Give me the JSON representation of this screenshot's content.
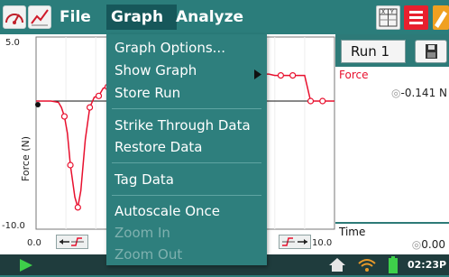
{
  "menubar": {
    "menus": [
      {
        "label": "File"
      },
      {
        "label": "Graph"
      },
      {
        "label": "Analyze"
      }
    ]
  },
  "graph_menu": {
    "items": [
      {
        "label": "Graph Options...",
        "enabled": true
      },
      {
        "label": "Show Graph",
        "enabled": true,
        "submenu": true
      },
      {
        "label": "Store Run",
        "enabled": true
      },
      {
        "label": "Strike Through Data",
        "enabled": true
      },
      {
        "label": "Restore Data",
        "enabled": true
      },
      {
        "label": "Tag Data",
        "enabled": true
      },
      {
        "label": "Autoscale Once",
        "enabled": true
      },
      {
        "label": "Zoom In",
        "enabled": false
      },
      {
        "label": "Zoom Out",
        "enabled": false
      }
    ]
  },
  "graph": {
    "y_max_label": "5.0",
    "y_min_label": "-10.0",
    "x_min_label": "0.0",
    "x_max_label": "10.0",
    "y_axis_label": "Force (N)"
  },
  "chart_data": {
    "type": "line",
    "title": "",
    "xlabel": "",
    "ylabel": "Force (N)",
    "xlim": [
      0,
      10
    ],
    "ylim": [
      -10,
      5
    ],
    "series": [
      {
        "name": "Force",
        "color": "#e8102e",
        "x": [
          0.0,
          0.25,
          0.5,
          0.75,
          0.85,
          0.95,
          1.05,
          1.15,
          1.3,
          1.4,
          1.5,
          1.65,
          1.8,
          1.95,
          2.1,
          2.25,
          2.4,
          2.55,
          2.7,
          2.85,
          3.0,
          3.1,
          3.15,
          3.3,
          3.5,
          3.6,
          3.75,
          4.0,
          4.5,
          5.0,
          5.5,
          6.0,
          6.5,
          6.8,
          7.0,
          7.2,
          7.4,
          7.6,
          7.8,
          8.0,
          8.2,
          8.4,
          8.6,
          8.8,
          9.0,
          9.2,
          9.5,
          9.8,
          10.0
        ],
        "y": [
          0.0,
          0.0,
          0.0,
          -0.1,
          -0.5,
          -1.2,
          -2.5,
          -5.0,
          -7.5,
          -8.3,
          -7.0,
          -3.0,
          -0.5,
          0.3,
          0.4,
          1.0,
          1.1,
          2.3,
          2.4,
          2.4,
          2.1,
          2.0,
          2.2,
          2.2,
          1.9,
          2.1,
          2.0,
          2.1,
          2.1,
          2.1,
          2.1,
          2.1,
          2.1,
          2.1,
          2.1,
          2.1,
          2.1,
          2.1,
          2.1,
          2.0,
          2.0,
          2.0,
          2.0,
          2.0,
          2.0,
          0.0,
          0.0,
          0.0,
          0.0
        ]
      }
    ],
    "marked_x": [
      0.95,
      1.15,
      1.4,
      1.8,
      2.1,
      2.4,
      2.7,
      3.0,
      3.3,
      6.5,
      7.2,
      7.6,
      8.2,
      8.6,
      9.2,
      9.6
    ]
  },
  "right_panel": {
    "run_label": "Run 1",
    "meter1_label": "Force",
    "meter1_value": "-0.141 N",
    "meter2_label": "Time",
    "meter2_value": "0.00"
  },
  "status": {
    "time": "02:23P"
  },
  "colors": {
    "teal": "#2b7d7b",
    "menu_bg": "#2e7f7d",
    "series": "#e8102e"
  }
}
